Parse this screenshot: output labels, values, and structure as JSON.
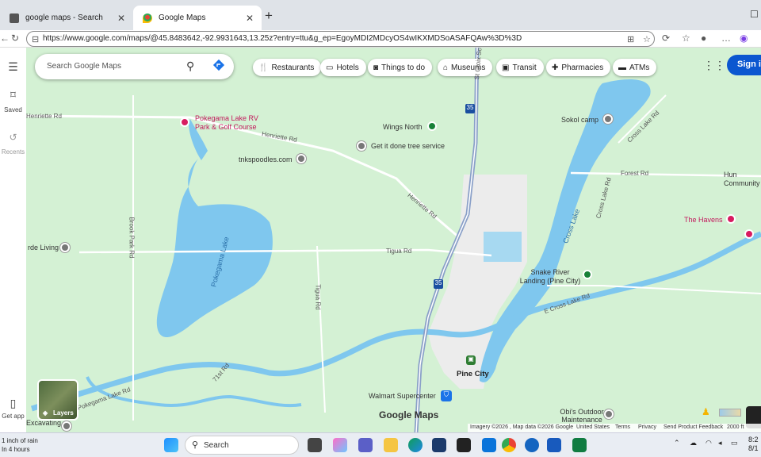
{
  "browser": {
    "tabs": [
      {
        "title": "google maps - Search"
      },
      {
        "title": "Google Maps"
      }
    ],
    "url": "https://www.google.com/maps/@45.8483642,-92.9931643,13.25z?entry=ttu&g_ep=EgoyMDI2MDcyOS4wIKXMDSoASAFQAw%3D%3D"
  },
  "sidebar": {
    "saved": "Saved",
    "recents": "Recents",
    "get_app": "Get app"
  },
  "search": {
    "placeholder": "Search Google Maps"
  },
  "chips": [
    "Restaurants",
    "Hotels",
    "Things to do",
    "Museums",
    "Transit",
    "Pharmacies",
    "ATMs"
  ],
  "sign_in": "Sign in",
  "map": {
    "roads": {
      "henriette_w": "Henriette Rd",
      "henriette_1": "Henriette Rd",
      "henriette_2": "Henriette Rd",
      "st_croix": "St Croix Scenic Byway",
      "cross_lake_rd": "Cross Lake Rd",
      "cross_lake_rd2": "Cross Lake Rd",
      "forest_rd": "Forest Rd",
      "brook_park_rd": "Brook Park Rd",
      "tigua_rd": "Tigua Rd",
      "tigua_rd2": "Tigua Rd",
      "pokegama_lake_rd": "Pokegama Lake Rd",
      "e_cross_lake_rd": "E Cross Lake Rd",
      "rd_71": "71st Rd"
    },
    "lakes": {
      "pokegama": "Pokegama Lake",
      "cross": "Cross Lake"
    },
    "places": {
      "pokegama_rv": "Pokegama Lake RV Park & Golf Course",
      "wings_north": "Wings North",
      "tree_service": "Get it done tree service",
      "tnkspoodles": "tnkspoodles.com",
      "sokol_camp": "Sokol camp",
      "havens": "The Havens",
      "community": "Community",
      "snake_river": "Snake River Landing (Pine City)",
      "pine_city": "Pine City",
      "walmart": "Walmart Supercenter",
      "obis": "Obi's Outdoor Maintenance",
      "excavating": "Excavating",
      "side_living": "rde Living",
      "hunt": "Hun"
    },
    "highway": "35",
    "highway_b": "35",
    "logo": "Google Maps",
    "layers": "Layers",
    "footer": {
      "imagery": "Imagery ©2026 , Map data ©2026 Google",
      "country": "United States",
      "terms": "Terms",
      "privacy": "Privacy",
      "feedback": "Send Product Feedback",
      "scale": "2000 ft"
    }
  },
  "taskbar": {
    "weather_line1": "1 inch of rain",
    "weather_line2": "In 4 hours",
    "search": "Search",
    "time": "8:2",
    "date": "8/1"
  }
}
